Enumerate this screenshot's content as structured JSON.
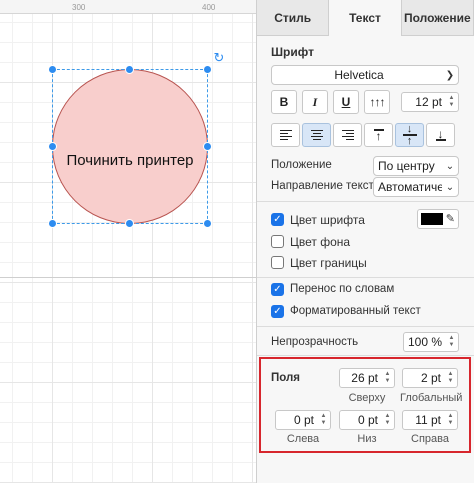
{
  "ruler": {
    "ticks": [
      "300",
      "400"
    ]
  },
  "canvas": {
    "shape_label": "Починить принтер"
  },
  "tabs": [
    "Стиль",
    "Текст",
    "Положение"
  ],
  "font": {
    "section_title": "Шрифт",
    "family": "Helvetica",
    "style_buttons": [
      "B",
      "I",
      "U"
    ],
    "size": "12 pt",
    "position_label": "Положение",
    "position_value": "По центру",
    "direction_label": "Направление текста",
    "direction_value": "Автоматичес"
  },
  "colors": {
    "font_color_label": "Цвет шрифта",
    "font_color_checked": true,
    "font_color": "#000000",
    "background_label": "Цвет фона",
    "background_checked": false,
    "border_label": "Цвет границы",
    "border_checked": false
  },
  "wrap": {
    "word_wrap_label": "Перенос по словам",
    "word_wrap_checked": true,
    "formatted_label": "Форматированный текст",
    "formatted_checked": true
  },
  "opacity": {
    "label": "Непрозрачность",
    "value": "100 %"
  },
  "margins": {
    "title": "Поля",
    "top": {
      "value": "26 pt",
      "label": "Сверху"
    },
    "global": {
      "value": "2 pt",
      "label": "Глобальный"
    },
    "left": {
      "value": "0 pt",
      "label": "Слева"
    },
    "bottom": {
      "value": "0 pt",
      "label": "Низ"
    },
    "right": {
      "value": "11 pt",
      "label": "Справа"
    }
  },
  "accent": {
    "selection": "#2d8cf0",
    "highlight": "#d7262d",
    "shape_fill": "#f8cecc",
    "shape_stroke": "#b85450"
  }
}
